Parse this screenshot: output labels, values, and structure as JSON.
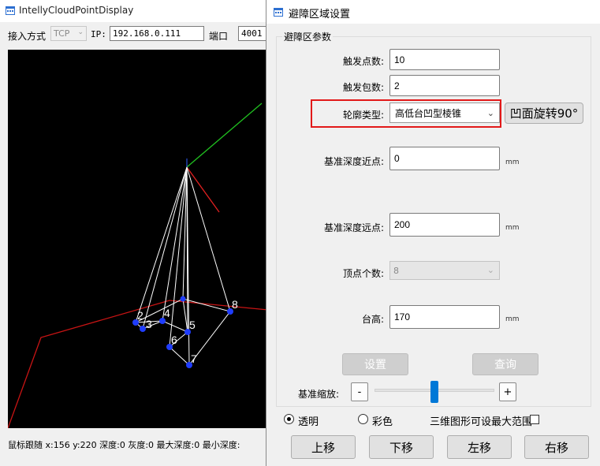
{
  "main_window": {
    "title": "IntellyCloudPointDisplay",
    "conn_label": "接入方式",
    "conn_value": "TCP",
    "ip_label": "IP:",
    "ip_value": "192.168.0.111",
    "port_label": "端口",
    "port_value": "4001",
    "status_text": "鼠标跟随 x:156 y:220 深度:0 灰度:0 最大深度:0 最小深度:"
  },
  "viewport": {
    "point_labels": [
      "2",
      "3",
      "4",
      "5",
      "6",
      "7",
      "8"
    ],
    "axis_colors": {
      "x": "#e02020",
      "y": "#20c020",
      "grid": "#c81414"
    },
    "point_color": "#1f3dff"
  },
  "dialog": {
    "title": "避障区域设置",
    "group_title": "避障区参数",
    "trigger_points_label": "触发点数:",
    "trigger_points_value": "10",
    "trigger_packets_label": "触发包数:",
    "trigger_packets_value": "2",
    "contour_type_label": "轮廓类型:",
    "contour_type_value": "高低台凹型棱锥",
    "rotate_button": "凹面旋转90°",
    "near_depth_label": "基准深度近点:",
    "near_depth_value": "0",
    "far_depth_label": "基准深度远点:",
    "far_depth_value": "200",
    "vertex_count_label": "顶点个数:",
    "vertex_count_value": "8",
    "platform_height_label": "台高:",
    "platform_height_value": "170",
    "unit": "mm",
    "set_button": "设置",
    "query_button": "查询",
    "scale_label": "基准缩放:",
    "minus": "-",
    "plus": "+",
    "scale_level": 0.5,
    "transparent_label": "透明",
    "color_label": "彩色",
    "max_range_label": "三维图形可设最大范围",
    "up_button": "上移",
    "down_button": "下移",
    "left_button": "左移",
    "right_button": "右移",
    "highlight_color": "#e21919",
    "accent": "#0078d7"
  }
}
